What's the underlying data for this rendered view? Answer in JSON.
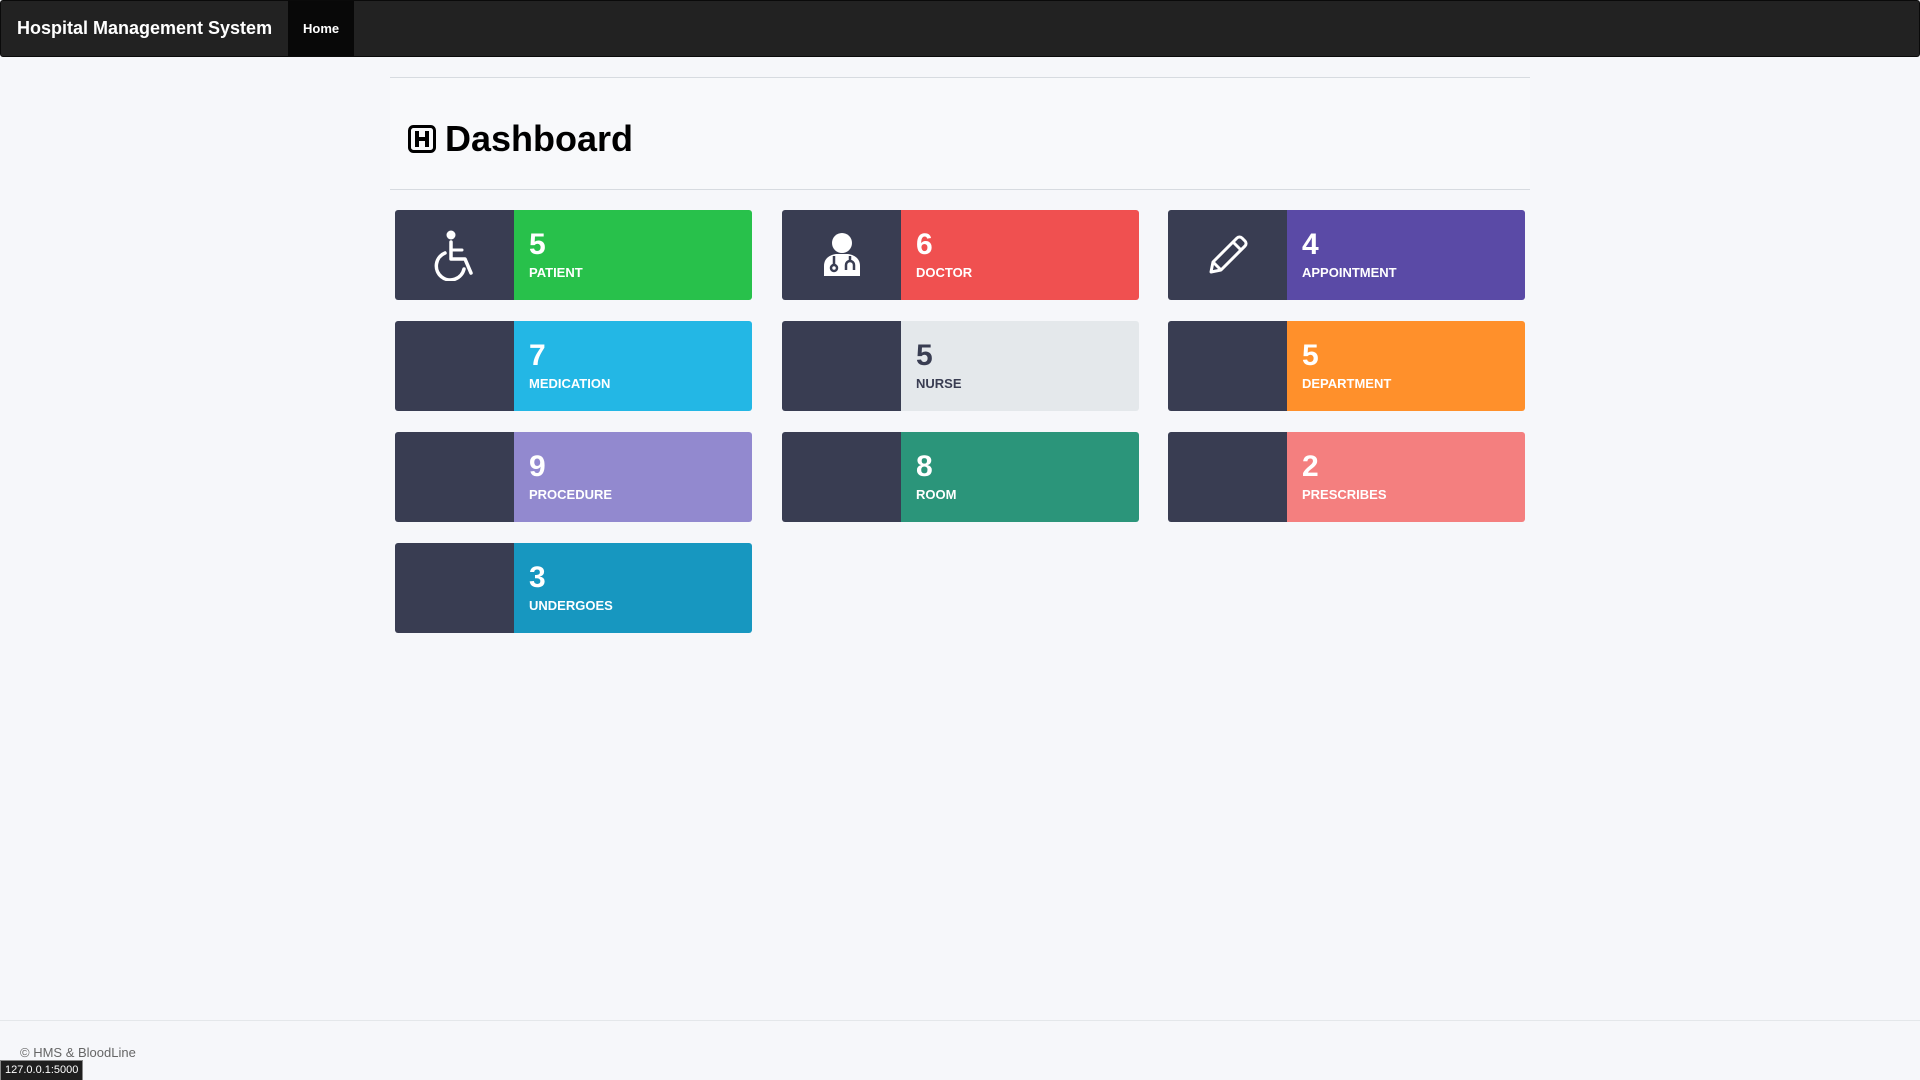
{
  "navbar": {
    "brand": "Hospital Management System",
    "home_label": "Home"
  },
  "page": {
    "title": "Dashboard",
    "title_icon": "hospital-h-icon"
  },
  "cards": [
    {
      "count": "5",
      "label": "PATIENT",
      "color": "#28c14b",
      "icon": "wheelchair-icon"
    },
    {
      "count": "6",
      "label": "DOCTOR",
      "color": "#f05050",
      "icon": "doctor-icon"
    },
    {
      "count": "4",
      "label": "APPOINTMENT",
      "color": "#5a4aa6",
      "icon": "pencil-icon"
    },
    {
      "count": "7",
      "label": "MEDICATION",
      "color": "#23b7e5",
      "icon": ""
    },
    {
      "count": "5",
      "label": "NURSE",
      "color": "#e4e8eb",
      "icon": ""
    },
    {
      "count": "5",
      "label": "DEPARTMENT",
      "color": "#ff902b",
      "icon": ""
    },
    {
      "count": "9",
      "label": "PROCEDURE",
      "color": "#9289cf",
      "icon": ""
    },
    {
      "count": "8",
      "label": "ROOM",
      "color": "#2b957a",
      "icon": ""
    },
    {
      "count": "2",
      "label": "PRESCRIBES",
      "color": "#f47f7f",
      "icon": ""
    },
    {
      "count": "3",
      "label": "UNDERGOES",
      "color": "#1797c0",
      "icon": ""
    }
  ],
  "footer": {
    "text": "© HMS & BloodLine"
  },
  "status_bar": {
    "url": "127.0.0.1:5000"
  }
}
